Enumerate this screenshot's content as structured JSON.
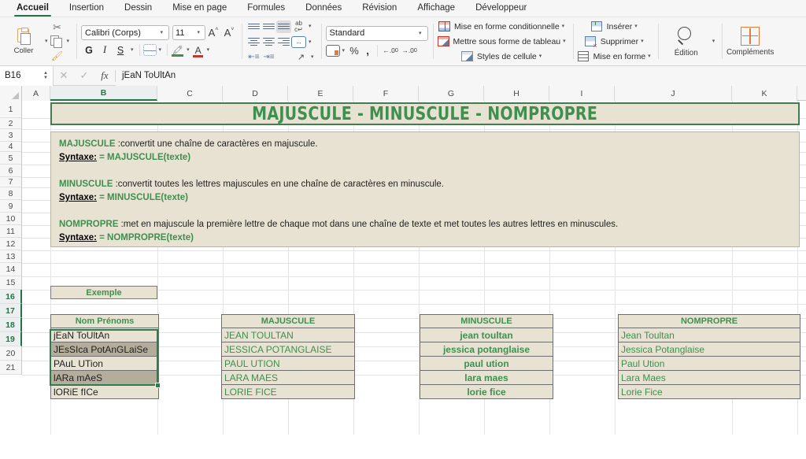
{
  "ribbon": {
    "tabs": [
      {
        "label": "Accueil",
        "active": true
      },
      {
        "label": "Insertion",
        "active": false
      },
      {
        "label": "Dessin",
        "active": false
      },
      {
        "label": "Mise en page",
        "active": false
      },
      {
        "label": "Formules",
        "active": false
      },
      {
        "label": "Données",
        "active": false
      },
      {
        "label": "Révision",
        "active": false
      },
      {
        "label": "Affichage",
        "active": false
      },
      {
        "label": "Développeur",
        "active": false
      }
    ],
    "clipboard": {
      "paste_label": "Coller"
    },
    "font": {
      "name_value": "Calibri (Corps)",
      "size_value": "11",
      "bold_label": "G",
      "italic_label": "I",
      "underline_label": "S"
    },
    "number": {
      "format_value": "Standard",
      "percent_label": "%",
      "comma_label": ","
    },
    "styles": {
      "conditional": "Mise en forme conditionnelle",
      "as_table": "Mettre sous forme de tableau",
      "cell_styles": "Styles de cellule"
    },
    "cells": {
      "insert": "Insérer",
      "delete": "Supprimer",
      "format": "Mise en forme"
    },
    "editing": {
      "label": "Édition"
    },
    "addins": {
      "label": "Compléments"
    }
  },
  "formula_bar": {
    "name_box": "B16",
    "cancel_icon": "✕",
    "confirm_icon": "✓",
    "fx_label": "fx",
    "content": "jEaN ToUltAn"
  },
  "grid": {
    "columns": [
      {
        "label": "A",
        "selected": false
      },
      {
        "label": "B",
        "selected": true
      },
      {
        "label": "C",
        "selected": false
      },
      {
        "label": "D",
        "selected": false
      },
      {
        "label": "E",
        "selected": false
      },
      {
        "label": "F",
        "selected": false
      },
      {
        "label": "G",
        "selected": false
      },
      {
        "label": "H",
        "selected": false
      },
      {
        "label": "I",
        "selected": false
      },
      {
        "label": "J",
        "selected": false
      },
      {
        "label": "K",
        "selected": false
      }
    ],
    "rows": [
      {
        "label": "1",
        "selected": false
      },
      {
        "label": "2",
        "selected": false
      },
      {
        "label": "3",
        "selected": false
      },
      {
        "label": "4",
        "selected": false
      },
      {
        "label": "5",
        "selected": false
      },
      {
        "label": "6",
        "selected": false
      },
      {
        "label": "7",
        "selected": false
      },
      {
        "label": "8",
        "selected": false
      },
      {
        "label": "9",
        "selected": false
      },
      {
        "label": "10",
        "selected": false
      },
      {
        "label": "11",
        "selected": false
      },
      {
        "label": "12",
        "selected": false
      },
      {
        "label": "13",
        "selected": false
      },
      {
        "label": "14",
        "selected": false
      },
      {
        "label": "15",
        "selected": false
      },
      {
        "label": "16",
        "selected": true
      },
      {
        "label": "17",
        "selected": true
      },
      {
        "label": "18",
        "selected": true
      },
      {
        "label": "19",
        "selected": true
      },
      {
        "label": "20",
        "selected": false
      },
      {
        "label": "21",
        "selected": false
      }
    ],
    "selected_range": "B16:B19"
  },
  "sheet": {
    "title": "MAJUSCULE - MINUSCULE - NOMPROPRE",
    "descriptions": [
      {
        "fn": "MAJUSCULE",
        "desc": " :convertit une chaîne de caractères en majuscule.",
        "syntax_label": "Syntaxe:",
        "syntax_formula": "= MAJUSCULE(texte)"
      },
      {
        "fn": "MINUSCULE",
        "desc": " :convertit toutes les lettres majuscules en une chaîne de caractères en minuscule.",
        "syntax_label": "Syntaxe:",
        "syntax_formula": "= MINUSCULE(texte)"
      },
      {
        "fn": "NOMPROPRE",
        "desc": " :met en majuscule la première lettre de chaque mot dans une chaîne de texte et met toutes les autres lettres en minuscules.",
        "syntax_label": "Syntaxe:",
        "syntax_formula": "= NOMPROPRE(texte)"
      }
    ],
    "example_label": "Exemple",
    "tables": [
      {
        "header": "Nom Prénoms",
        "values": [
          "jEaN ToUltAn",
          "JEsSIca PotAnGLaiSe",
          "PAuL UTion",
          "lARa mAeS",
          "lORiE fICe"
        ],
        "style": "plain-left-banded"
      },
      {
        "header": "MAJUSCULE",
        "values": [
          "JEAN TOULTAN",
          "JESSICA POTANGLAISE",
          "PAUL UTION",
          "LARA MAES",
          "LORIE FICE"
        ],
        "style": "green-left"
      },
      {
        "header": "MINUSCULE",
        "values": [
          "jean toultan",
          "jessica potanglaise",
          "paul ution",
          "lara maes",
          "lorie fice"
        ],
        "style": "green-center-bold"
      },
      {
        "header": "NOMPROPRE",
        "values": [
          "Jean Toultan",
          "Jessica Potanglaise",
          "Paul Ution",
          "Lara Maes",
          "Lorie Fice"
        ],
        "style": "green-left"
      }
    ]
  },
  "colors": {
    "accent_green": "#3f8f4f",
    "tab_underline": "#227447",
    "panel_beige": "#e8e2d2",
    "band_dark": "#b5ad9b",
    "selection_border": "#2f7d4f"
  }
}
